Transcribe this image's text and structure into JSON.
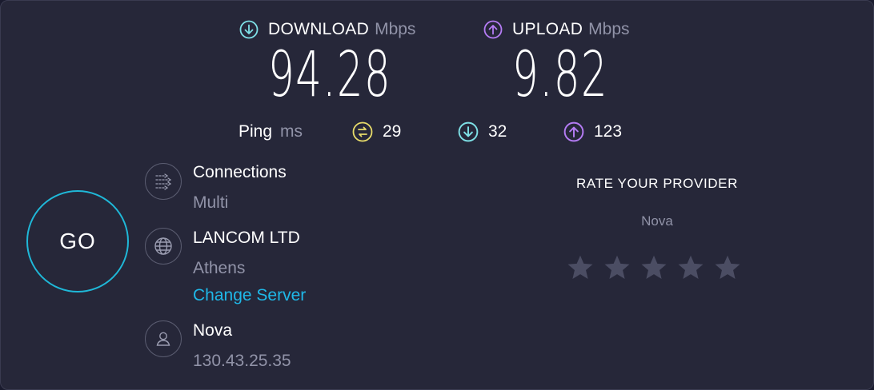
{
  "download": {
    "label": "DOWNLOAD",
    "unit": "Mbps",
    "value": "94.28",
    "icon": "arrow-down-circle-icon",
    "color": "#7ee0e6"
  },
  "upload": {
    "label": "UPLOAD",
    "unit": "Mbps",
    "value": "9.82",
    "icon": "arrow-up-circle-icon",
    "color": "#b57cf5"
  },
  "ping": {
    "label": "Ping",
    "unit": "ms",
    "idle": {
      "value": "29",
      "icon": "jitter-icon",
      "color": "#e8dc6a"
    },
    "download": {
      "value": "32",
      "icon": "arrow-down-circle-icon",
      "color": "#7ee0e6"
    },
    "upload": {
      "value": "123",
      "icon": "arrow-up-circle-icon",
      "color": "#b57cf5"
    }
  },
  "go_button": {
    "label": "GO",
    "color": "#1fb8d8"
  },
  "connections": {
    "title": "Connections",
    "value": "Multi",
    "icon": "connections-icon"
  },
  "server": {
    "title": "LANCOM LTD",
    "location": "Athens",
    "change_link": "Change Server",
    "icon": "globe-icon"
  },
  "provider": {
    "title": "Nova",
    "ip": "130.43.25.35",
    "icon": "user-icon"
  },
  "rating": {
    "title": "RATE YOUR PROVIDER",
    "isp": "Nova",
    "stars_total": 5,
    "stars_selected": 0,
    "star_color": "#4b4d63"
  }
}
